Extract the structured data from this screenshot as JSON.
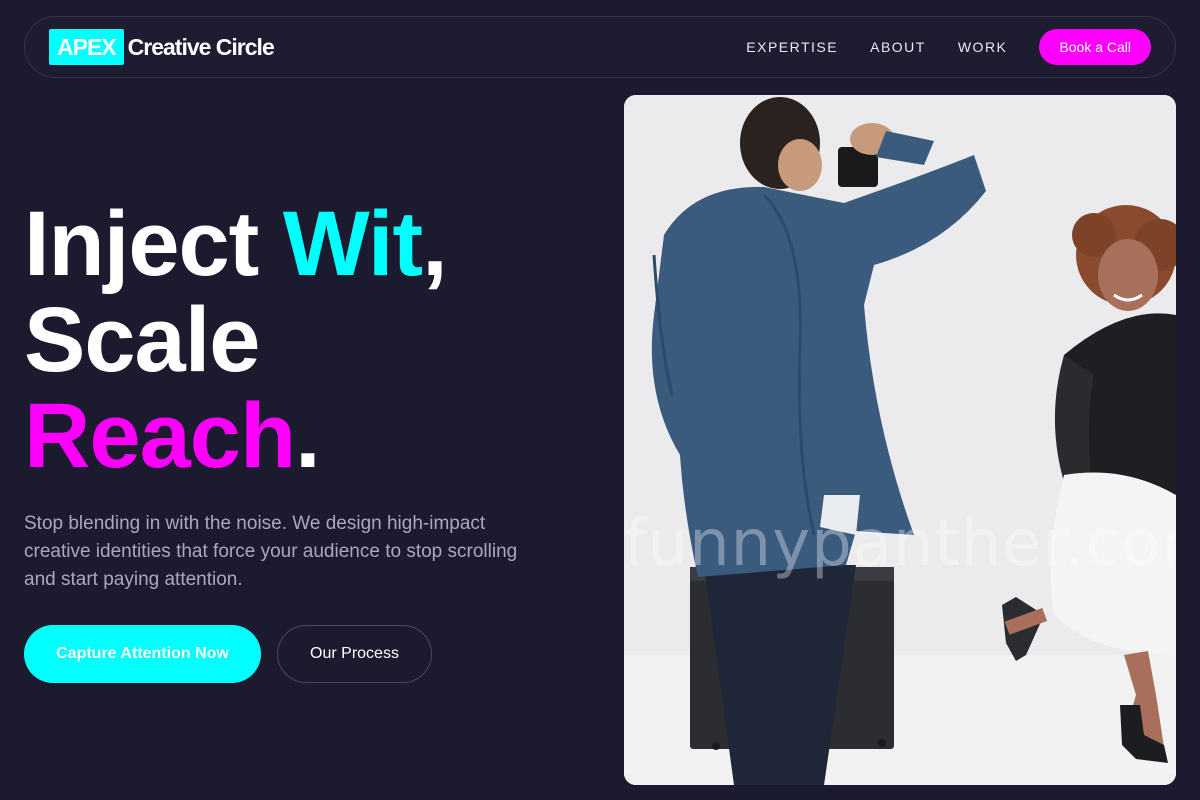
{
  "brand": {
    "badge": "APEX",
    "name": "Creative Circle"
  },
  "nav": {
    "links": [
      "EXPERTISE",
      "ABOUT",
      "WORK"
    ],
    "cta": "Book a Call"
  },
  "hero": {
    "headline": {
      "line1_a": "Inject ",
      "line1_b": "Wit",
      "line1_c": ",",
      "line2": "Scale",
      "line3_a": "Reach",
      "line3_b": "."
    },
    "subtext": "Stop blending in with the noise. We design high-impact creative identities that force your audience to stop scrolling and start paying attention.",
    "primary_button": "Capture Attention Now",
    "secondary_button": "Our Process",
    "image_watermark": "funnypanther.com"
  },
  "colors": {
    "background": "#1c1a2e",
    "accent_cyan": "#00ffff",
    "accent_magenta": "#ff00ff",
    "muted_text": "#a9a8bd"
  }
}
